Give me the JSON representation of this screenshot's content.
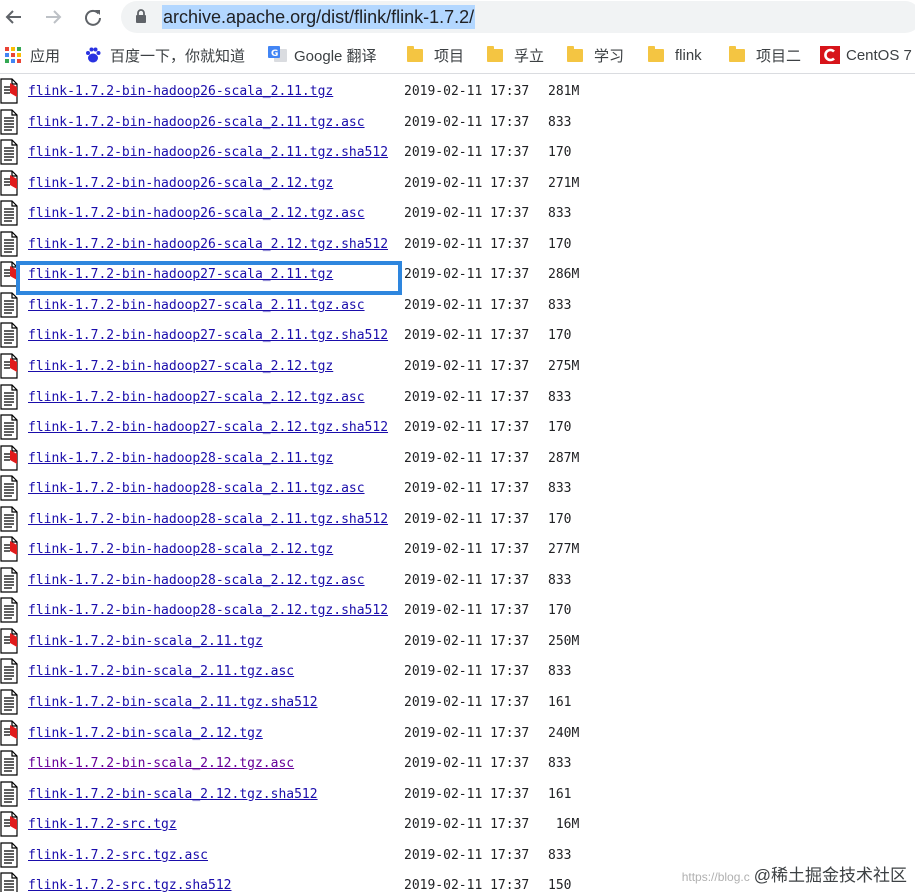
{
  "browser": {
    "url": "archive.apache.org/dist/flink/flink-1.7.2/",
    "icons": {
      "back": "back-arrow-icon",
      "forward": "forward-arrow-icon",
      "reload": "reload-icon",
      "lock": "lock-icon"
    }
  },
  "bookmarks": [
    {
      "label": "应用",
      "icon": "apps-grid-icon"
    },
    {
      "label": "百度一下，你就知道",
      "icon": "baidu-paw-icon"
    },
    {
      "label": "Google 翻译",
      "icon": "google-translate-icon"
    },
    {
      "label": "项目",
      "icon": "folder-icon"
    },
    {
      "label": "孚立",
      "icon": "folder-icon"
    },
    {
      "label": "学习",
      "icon": "folder-icon"
    },
    {
      "label": "flink",
      "icon": "folder-icon"
    },
    {
      "label": "项目二",
      "icon": "folder-icon"
    },
    {
      "label": "CentOS 7",
      "icon": "centos-c-icon"
    }
  ],
  "files": [
    {
      "name": "flink-1.7.2-bin-hadoop26-scala_2.11.tgz",
      "date": "2019-02-11 17:37",
      "size": "281M",
      "type": "archive"
    },
    {
      "name": "flink-1.7.2-bin-hadoop26-scala_2.11.tgz.asc",
      "date": "2019-02-11 17:37",
      "size": "833",
      "type": "text"
    },
    {
      "name": "flink-1.7.2-bin-hadoop26-scala_2.11.tgz.sha512",
      "date": "2019-02-11 17:37",
      "size": "170",
      "type": "text"
    },
    {
      "name": "flink-1.7.2-bin-hadoop26-scala_2.12.tgz",
      "date": "2019-02-11 17:37",
      "size": "271M",
      "type": "archive"
    },
    {
      "name": "flink-1.7.2-bin-hadoop26-scala_2.12.tgz.asc",
      "date": "2019-02-11 17:37",
      "size": "833",
      "type": "text"
    },
    {
      "name": "flink-1.7.2-bin-hadoop26-scala_2.12.tgz.sha512",
      "date": "2019-02-11 17:37",
      "size": "170",
      "type": "text"
    },
    {
      "name": "flink-1.7.2-bin-hadoop27-scala_2.11.tgz",
      "date": "2019-02-11 17:37",
      "size": "286M",
      "type": "archive",
      "highlighted": true
    },
    {
      "name": "flink-1.7.2-bin-hadoop27-scala_2.11.tgz.asc",
      "date": "2019-02-11 17:37",
      "size": "833",
      "type": "text"
    },
    {
      "name": "flink-1.7.2-bin-hadoop27-scala_2.11.tgz.sha512",
      "date": "2019-02-11 17:37",
      "size": "170",
      "type": "text"
    },
    {
      "name": "flink-1.7.2-bin-hadoop27-scala_2.12.tgz",
      "date": "2019-02-11 17:37",
      "size": "275M",
      "type": "archive"
    },
    {
      "name": "flink-1.7.2-bin-hadoop27-scala_2.12.tgz.asc",
      "date": "2019-02-11 17:37",
      "size": "833",
      "type": "text"
    },
    {
      "name": "flink-1.7.2-bin-hadoop27-scala_2.12.tgz.sha512",
      "date": "2019-02-11 17:37",
      "size": "170",
      "type": "text"
    },
    {
      "name": "flink-1.7.2-bin-hadoop28-scala_2.11.tgz",
      "date": "2019-02-11 17:37",
      "size": "287M",
      "type": "archive"
    },
    {
      "name": "flink-1.7.2-bin-hadoop28-scala_2.11.tgz.asc",
      "date": "2019-02-11 17:37",
      "size": "833",
      "type": "text"
    },
    {
      "name": "flink-1.7.2-bin-hadoop28-scala_2.11.tgz.sha512",
      "date": "2019-02-11 17:37",
      "size": "170",
      "type": "text"
    },
    {
      "name": "flink-1.7.2-bin-hadoop28-scala_2.12.tgz",
      "date": "2019-02-11 17:37",
      "size": "277M",
      "type": "archive"
    },
    {
      "name": "flink-1.7.2-bin-hadoop28-scala_2.12.tgz.asc",
      "date": "2019-02-11 17:37",
      "size": "833",
      "type": "text"
    },
    {
      "name": "flink-1.7.2-bin-hadoop28-scala_2.12.tgz.sha512",
      "date": "2019-02-11 17:37",
      "size": "170",
      "type": "text"
    },
    {
      "name": "flink-1.7.2-bin-scala_2.11.tgz",
      "date": "2019-02-11 17:37",
      "size": "250M",
      "type": "archive"
    },
    {
      "name": "flink-1.7.2-bin-scala_2.11.tgz.asc",
      "date": "2019-02-11 17:37",
      "size": "833",
      "type": "text"
    },
    {
      "name": "flink-1.7.2-bin-scala_2.11.tgz.sha512",
      "date": "2019-02-11 17:37",
      "size": "161",
      "type": "text"
    },
    {
      "name": "flink-1.7.2-bin-scala_2.12.tgz",
      "date": "2019-02-11 17:37",
      "size": "240M",
      "type": "archive"
    },
    {
      "name": "flink-1.7.2-bin-scala_2.12.tgz.asc",
      "date": "2019-02-11 17:37",
      "size": "833",
      "type": "text",
      "visited": true
    },
    {
      "name": "flink-1.7.2-bin-scala_2.12.tgz.sha512",
      "date": "2019-02-11 17:37",
      "size": "161",
      "type": "text"
    },
    {
      "name": "flink-1.7.2-src.tgz",
      "date": "2019-02-11 17:37",
      "size": " 16M",
      "type": "archive"
    },
    {
      "name": "flink-1.7.2-src.tgz.asc",
      "date": "2019-02-11 17:37",
      "size": "833",
      "type": "text"
    },
    {
      "name": "flink-1.7.2-src.tgz.sha512",
      "date": "2019-02-11 17:37",
      "size": "150",
      "type": "text"
    }
  ],
  "watermark": {
    "faint": "https://blog.c",
    "text": "@稀土掘金技术社区"
  },
  "colors": {
    "link": "#1a0dab",
    "visited": "#660099",
    "highlight": "#2e86de",
    "url_selection": "#b3d7ff"
  }
}
